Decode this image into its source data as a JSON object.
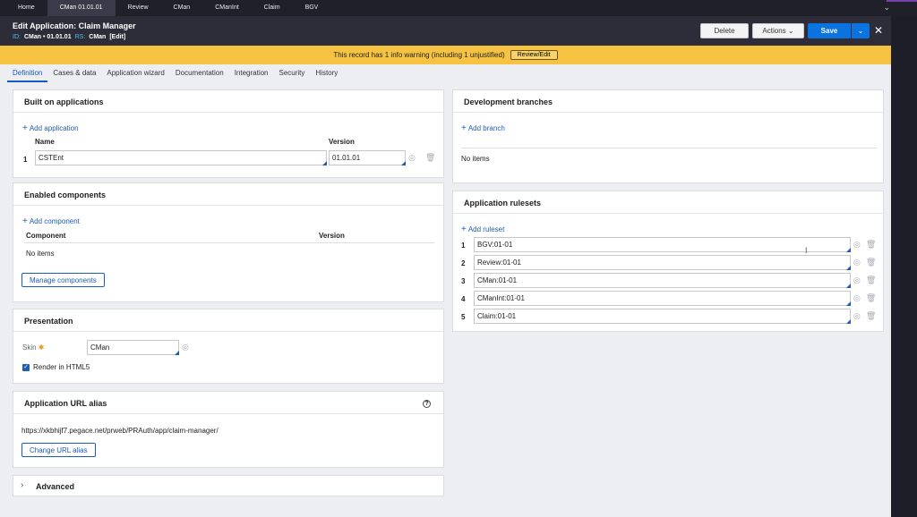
{
  "top_tabs": [
    "Home",
    "CMan 01.01.01",
    "Review",
    "CMan",
    "CManInt",
    "Claim",
    "BGV"
  ],
  "header": {
    "title": "Edit  Application: Claim Manager",
    "id_label": "ID:",
    "id_value": "CMan • 01.01.01",
    "rs_label": "RS:",
    "rs_value": "CMan",
    "edit_label": "[Edit]"
  },
  "actions": {
    "delete": "Delete",
    "actions": "Actions",
    "save": "Save"
  },
  "warning": {
    "message": "This record has 1 info warning (including 1 unjustified)",
    "button": "Review/Edit"
  },
  "subtabs": [
    "Definition",
    "Cases & data",
    "Application wizard",
    "Documentation",
    "Integration",
    "Security",
    "History"
  ],
  "built_on": {
    "title": "Built on applications",
    "add": "Add application",
    "col_name": "Name",
    "col_version": "Version",
    "rows": [
      {
        "num": "1",
        "name": "CSTEnt",
        "version": "01.01.01"
      }
    ]
  },
  "components": {
    "title": "Enabled components",
    "add": "Add component",
    "col_component": "Component",
    "col_version": "Version",
    "empty": "No items",
    "manage": "Manage components"
  },
  "presentation": {
    "title": "Presentation",
    "skin_label": "Skin",
    "skin_value": "CMan",
    "render_html5": "Render in HTML5"
  },
  "url_alias": {
    "title": "Application URL alias",
    "url": "https://xkbhijf7.pegace.net/prweb/PRAuth/app/claim-manager/",
    "button": "Change URL alias"
  },
  "advanced": {
    "title": "Advanced"
  },
  "dev_branches": {
    "title": "Development branches",
    "add": "Add branch",
    "empty": "No items"
  },
  "rulesets": {
    "title": "Application rulesets",
    "add": "Add ruleset",
    "rows": [
      {
        "num": "1",
        "value": "BGV:01-01"
      },
      {
        "num": "2",
        "value": "Review:01-01"
      },
      {
        "num": "3",
        "value": "CMan:01-01"
      },
      {
        "num": "4",
        "value": "CManInt:01-01"
      },
      {
        "num": "5",
        "value": "Claim:01-01"
      }
    ]
  },
  "colors": {
    "accent": "#0b73e0",
    "warning": "#f5c242",
    "header": "#2d2d3a"
  }
}
